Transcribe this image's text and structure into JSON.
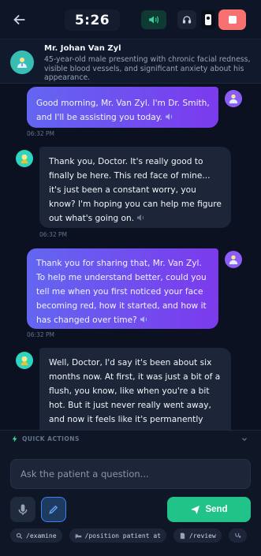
{
  "header": {
    "timer": "5:26"
  },
  "patient": {
    "name": "Mr. Johan Van Zyl",
    "description": "45-year-old male presenting with chronic facial redness, visible blood vessels, and significant anxiety about his appearance."
  },
  "messages": [
    {
      "role": "doctor",
      "text": "Good morning, Mr. Van Zyl. I'm Dr. Smith, and I'll be assisting you today.",
      "time": "06:32 PM"
    },
    {
      "role": "patient",
      "text": "Thank you, Doctor. It's really good to finally be here. This red face of mine... it's just been a constant worry, you know? I'm hoping you can help me figure out what's going on.",
      "time": "06:32 PM"
    },
    {
      "role": "doctor",
      "text": "Thank you for sharing that, Mr. Van Zyl. To help me understand better, could you tell me when you first noticed your face becoming red, how it started, and how it has changed over time?",
      "time": "06:32 PM"
    },
    {
      "role": "patient",
      "text": "Well, Doctor, I'd say it's been about six months now. At first, it was just a bit of a flush, you know, like when you're a bit hot. But it just never really went away, and now it feels like it's permanently red, especially on my cheeks. And it gets worse with",
      "time": ""
    }
  ],
  "quick_actions": {
    "label": "QUICK ACTIONS"
  },
  "composer": {
    "placeholder": "Ask the patient a question...",
    "send_label": "Send"
  },
  "commands": [
    {
      "icon": "search-icon",
      "label": "/examine"
    },
    {
      "icon": "bed-icon",
      "label": "/position patient at"
    },
    {
      "icon": "document-icon",
      "label": "/review"
    }
  ],
  "colors": {
    "send": "#22c389",
    "stop": "#f87171",
    "doctor_bubble": "#6366f1",
    "patient_bubble": "#1c2638"
  }
}
